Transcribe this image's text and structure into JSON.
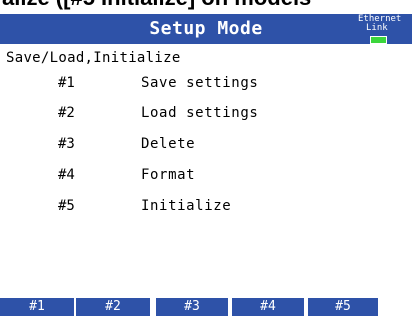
{
  "caption": "alize ([#5 Initialize] on models",
  "header": {
    "title": "Setup Mode",
    "ethernet_label": "Ethernet",
    "link_label": "Link",
    "link_led_color": "#3cd63c"
  },
  "section": {
    "title": "Save/Load,Initialize"
  },
  "menu": {
    "items": [
      {
        "number": "#1",
        "label": "Save settings"
      },
      {
        "number": "#2",
        "label": "Load settings"
      },
      {
        "number": "#3",
        "label": "Delete"
      },
      {
        "number": "#4",
        "label": "Format"
      },
      {
        "number": "#5",
        "label": "Initialize"
      }
    ]
  },
  "softkeys": [
    "#1",
    "#2",
    "#3",
    "#4",
    "#5"
  ],
  "colors": {
    "bar_blue": "#2e52a8",
    "background": "#ffffff"
  }
}
